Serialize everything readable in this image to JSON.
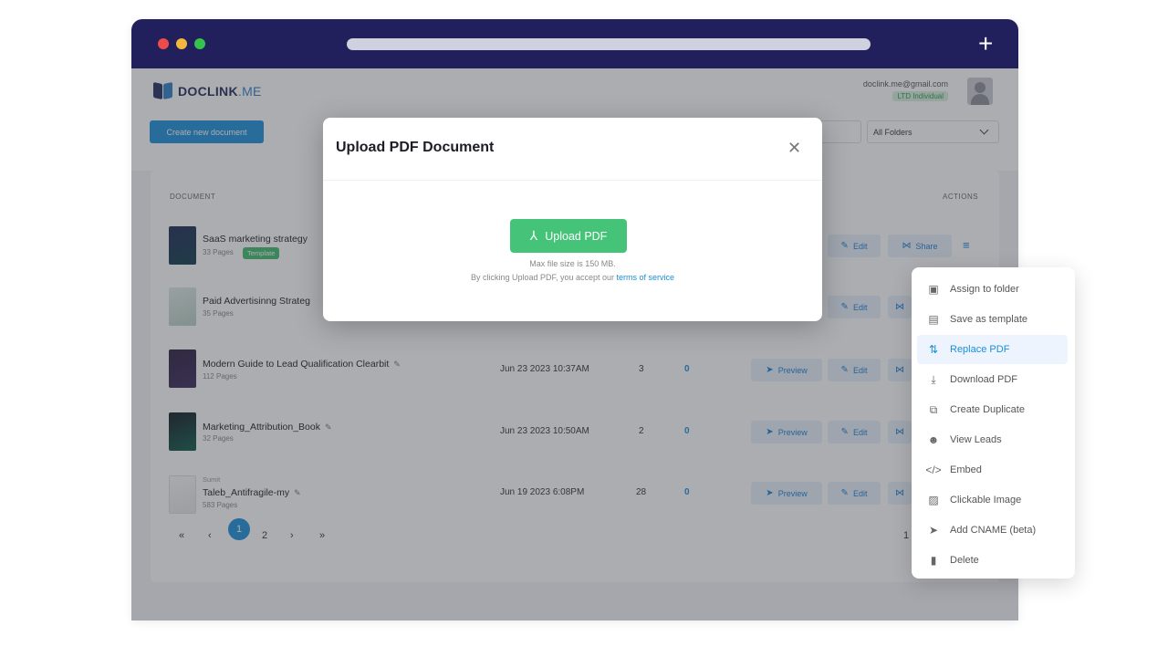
{
  "window": {
    "controls": [
      "close",
      "minimize",
      "maximize"
    ],
    "new_tab_icon": "plus-icon"
  },
  "header": {
    "logo_text": "DOCLINK",
    "logo_tld": ".ME",
    "account_email": "doclink.me@gmail.com",
    "plan_badge": "LTD Individual"
  },
  "toolbar": {
    "create_label": "Create new document",
    "folder_select_value": "All Folders"
  },
  "table": {
    "col_document": "DOCUMENT",
    "col_actions": "ACTIONS",
    "preview_label": "Preview",
    "edit_label": "Edit",
    "share_label": "Share",
    "rows": [
      {
        "title": "SaaS marketing strategy",
        "pages": "33 Pages",
        "tag": "Template",
        "date": "",
        "views": "",
        "leads": ""
      },
      {
        "title": "Paid Advertisinng Strateg",
        "pages": "35 Pages",
        "date": "",
        "views": "",
        "leads": ""
      },
      {
        "title": "Modern Guide to Lead Qualification Clearbit",
        "pages": "112 Pages",
        "date": "Jun 23 2023 10:37AM",
        "views": "3",
        "leads": "0"
      },
      {
        "title": "Marketing_Attribution_Book",
        "pages": "32 Pages",
        "date": "Jun 23 2023 10:50AM",
        "views": "2",
        "leads": "0"
      },
      {
        "owner": "Sumit",
        "title": "Taleb_Antifragile-my",
        "pages": "583 Pages",
        "date": "Jun 19 2023 6:08PM",
        "views": "28",
        "leads": "0"
      }
    ]
  },
  "pagination": {
    "first": "«",
    "prev": "‹",
    "pages": [
      "1",
      "2"
    ],
    "current": "1",
    "next": "›",
    "last": "»",
    "total_partial": "1"
  },
  "modal": {
    "title": "Upload PDF Document",
    "close_glyph": "✕",
    "upload_label": "Upload PDF",
    "max_size": "Max file size is 150 MB.",
    "accept_text": "By clicking Upload PDF, you accept our",
    "tos_link": "terms of service"
  },
  "actions_menu": {
    "items": [
      {
        "label": "Assign to folder",
        "icon": "folder-plus-icon"
      },
      {
        "label": "Save as template",
        "icon": "template-icon"
      },
      {
        "label": "Replace PDF",
        "icon": "swap-icon",
        "active": true
      },
      {
        "label": "Download PDF",
        "icon": "download-icon"
      },
      {
        "label": "Create Duplicate",
        "icon": "duplicate-icon"
      },
      {
        "label": "View Leads",
        "icon": "users-icon"
      },
      {
        "label": "Embed",
        "icon": "code-icon"
      },
      {
        "label": "Clickable Image",
        "icon": "image-icon"
      },
      {
        "label": "Add CNAME (beta)",
        "icon": "send-icon"
      },
      {
        "label": "Delete",
        "icon": "trash-icon"
      }
    ]
  },
  "colors": {
    "titlebar": "#211f5c",
    "accent_blue": "#1a8fd8",
    "upload_green": "#45c479",
    "template_tag": "#3ebc6c"
  }
}
